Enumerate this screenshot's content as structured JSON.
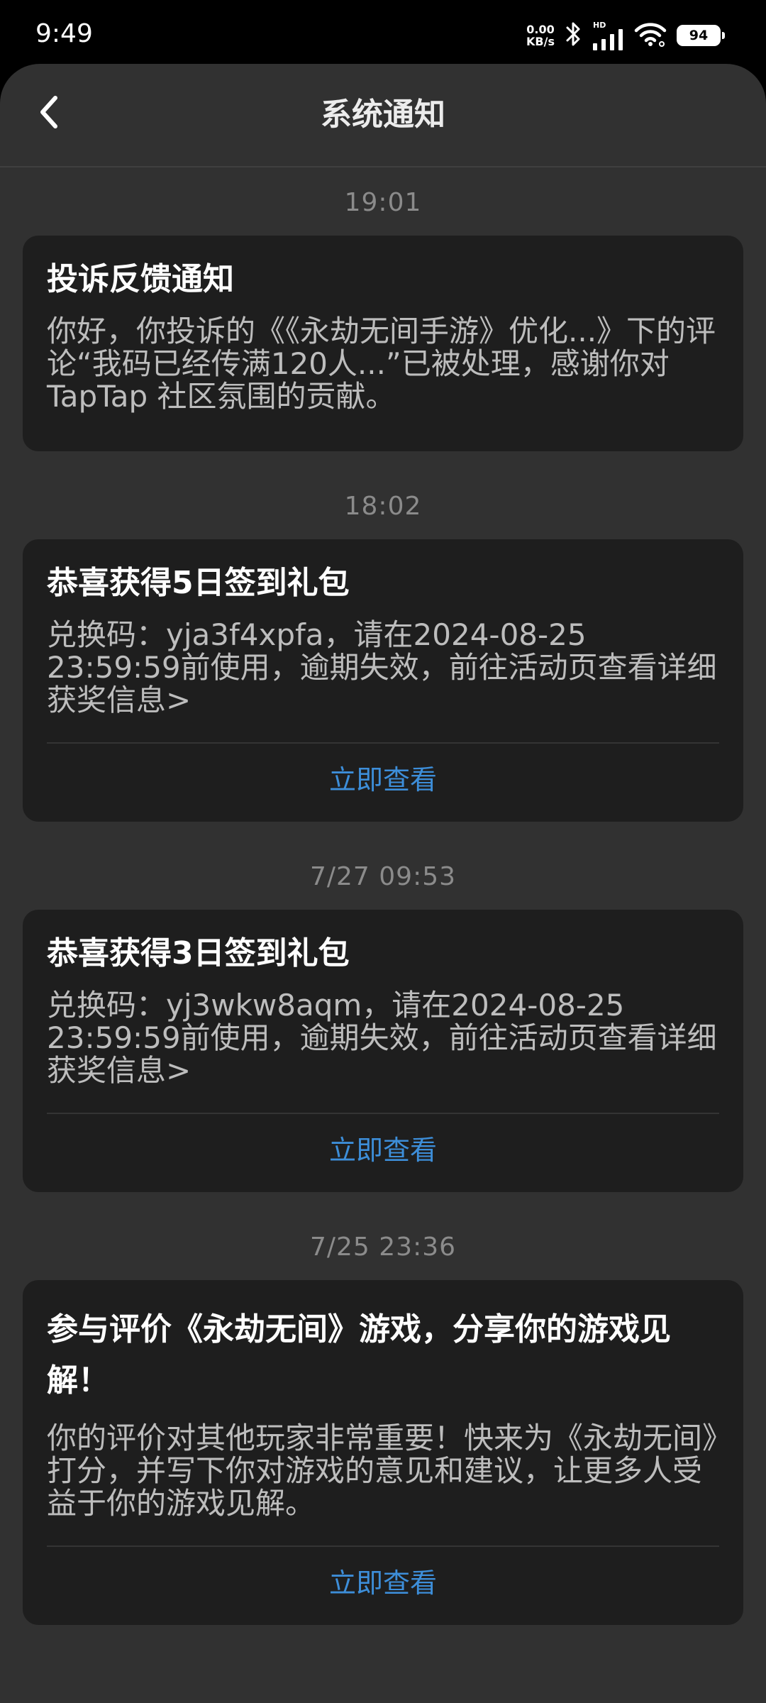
{
  "status_bar": {
    "time": "9:49",
    "net_speed_value": "0.00",
    "net_speed_unit": "KB/s",
    "signal_label": "HD",
    "battery": "94"
  },
  "header": {
    "title": "系统通知"
  },
  "notifications": [
    {
      "time": "19:01",
      "title": "投诉反馈通知",
      "body": "你好，你投诉的《《永劫无间手游》优化...》下的评论“我码已经传满120人...”已被处理，感谢你对 TapTap 社区氛围的贡献。"
    },
    {
      "time": "18:02",
      "title": "恭喜获得5日签到礼包",
      "body": "兑换码：yja3f4xpfa，请在2024-08-25 23:59:59前使用，逾期失效，前往活动页查看详细获奖信息>",
      "action": "立即查看"
    },
    {
      "time": "7/27  09:53",
      "title": "恭喜获得3日签到礼包",
      "body": "兑换码：yj3wkw8aqm，请在2024-08-25 23:59:59前使用，逾期失效，前往活动页查看详细获奖信息>",
      "action": "立即查看"
    },
    {
      "time": "7/25  23:36",
      "title": "参与评价《永劫无间》游戏，分享你的游戏见解！",
      "body": "你的评价对其他玩家非常重要！快来为《永劫无间》打分，并写下你对游戏的意见和建议，让更多人受益于你的游戏见解。",
      "action": "立即查看"
    }
  ]
}
